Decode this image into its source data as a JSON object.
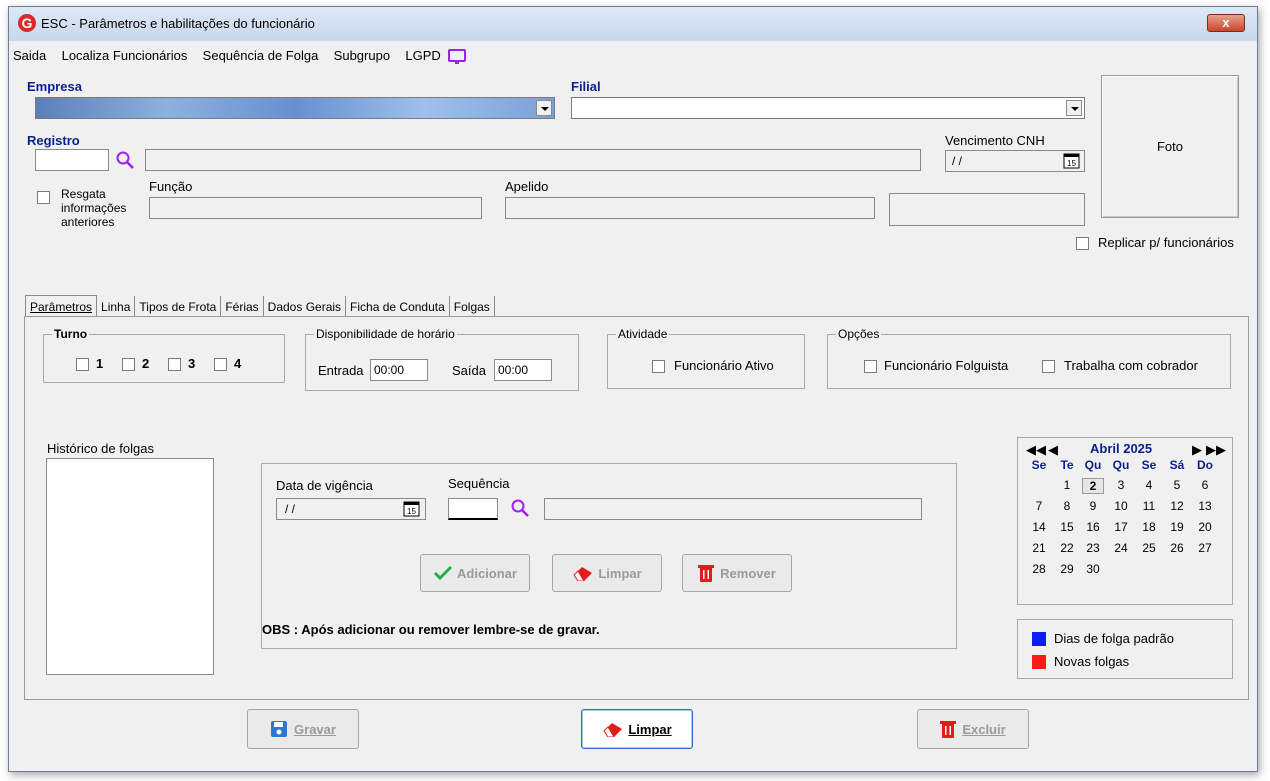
{
  "window": {
    "title": "ESC - Parâmetros e habilitações do funcionário",
    "close_label": "x"
  },
  "menu": [
    "Saida",
    "Localiza Funcionários",
    "Sequência de Folga",
    "Subgrupo",
    "LGPD"
  ],
  "form": {
    "empresa_label": "Empresa",
    "filial_label": "Filial",
    "registro_label": "Registro",
    "vencimento_label": "Vencimento CNH",
    "vencimento_value": "/ /",
    "resgata_label": "Resgata informações anteriores",
    "funcao_label": "Função",
    "apelido_label": "Apelido",
    "foto_label": "Foto",
    "replicar_label": "Replicar p/ funcionários"
  },
  "tabs": [
    "Parâmetros",
    "Linha",
    "Tipos de Frota",
    "Férias",
    "Dados Gerais",
    "Ficha de Conduta",
    "Folgas"
  ],
  "turno": {
    "legend": "Turno",
    "options": [
      "1",
      "2",
      "3",
      "4"
    ]
  },
  "disponibilidade": {
    "legend": "Disponibilidade de horário",
    "entrada_label": "Entrada",
    "entrada_value": "00:00",
    "saida_label": "Saída",
    "saida_value": "00:00"
  },
  "atividade": {
    "legend": "Atividade",
    "ativo_label": "Funcionário Ativo"
  },
  "opcoes": {
    "legend": "Opções",
    "folguista_label": "Funcionário Folguista",
    "cobrador_label": "Trabalha com cobrador"
  },
  "historico": {
    "label": "Histórico de folgas"
  },
  "vigencia": {
    "data_label": "Data de vigência",
    "data_value": "/ /",
    "sequencia_label": "Sequência",
    "adicionar": "Adicionar",
    "limpar": "Limpar",
    "remover": "Remover",
    "obs": "OBS : Após adicionar ou  remover lembre-se de gravar."
  },
  "calendar": {
    "month": "Abril 2025",
    "weekdays": [
      "Se",
      "Te",
      "Qu",
      "Qu",
      "Se",
      "Sá",
      "Do"
    ],
    "weeks": [
      [
        "",
        "1",
        "2",
        "3",
        "4",
        "5",
        "6"
      ],
      [
        "7",
        "8",
        "9",
        "10",
        "11",
        "12",
        "13"
      ],
      [
        "14",
        "15",
        "16",
        "17",
        "18",
        "19",
        "20"
      ],
      [
        "21",
        "22",
        "23",
        "24",
        "25",
        "26",
        "27"
      ],
      [
        "28",
        "29",
        "30",
        "",
        "",
        "",
        ""
      ]
    ],
    "today": "2"
  },
  "legend": {
    "padrao": "Dias de folga padrão",
    "novas": "Novas folgas",
    "padrao_color": "#0a1bff",
    "novas_color": "#ff1a1a"
  },
  "footer": {
    "gravar": "Gravar",
    "limpar": "Limpar",
    "excluir": "Excluir"
  }
}
